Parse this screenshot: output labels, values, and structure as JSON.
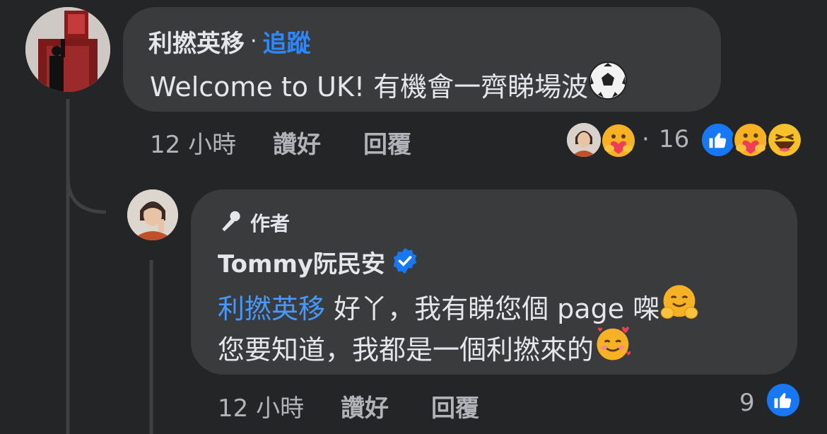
{
  "comment": {
    "author": "利撚英移",
    "separator": "·",
    "follow_label": "追蹤",
    "text": "Welcome to UK! 有機會一齊睇場波",
    "text_emoji": "soccer-ball",
    "time": "12 小時",
    "like_label": "讚好",
    "reply_label": "回覆",
    "reaction_dot": "·",
    "reaction_count": "16",
    "reactions": [
      "like",
      "care",
      "haha"
    ]
  },
  "reply": {
    "author_badge": "作者",
    "author": "Tommy阮民安",
    "verified": true,
    "mention": "利撚英移",
    "line1": " 好丫，我有睇您個 page 㗎",
    "line2": "您要知道，我都是一個利撚來的",
    "time": "12 小時",
    "like_label": "讚好",
    "reply_label": "回覆",
    "like_count": "9"
  },
  "colors": {
    "background": "#242526",
    "bubble": "#3a3b3c",
    "link": "#2d88ff",
    "like": "#1877f2",
    "muted": "#b0b3b8"
  }
}
